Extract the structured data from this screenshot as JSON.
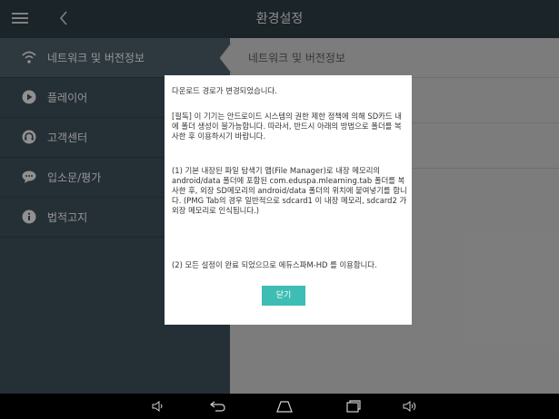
{
  "header": {
    "title": "환경설정",
    "menu_icon": "hamburger-menu-icon",
    "back_icon": "chevron-left-icon"
  },
  "sidebar": {
    "items": [
      {
        "label": "네트워크 및 버전정보",
        "icon": "wifi-icon",
        "active": true
      },
      {
        "label": "플레이어",
        "icon": "play-icon"
      },
      {
        "label": "고객센터",
        "icon": "headset-icon"
      },
      {
        "label": "입소문/평가",
        "icon": "chat-bubble-icon"
      },
      {
        "label": "법적고지",
        "icon": "info-icon"
      }
    ]
  },
  "content": {
    "header": "네트워크 및 버전정보"
  },
  "dialog": {
    "line1": "다운로드 경로가 변경되었습니다.",
    "line2": "[필독] 이 기기는 안드로이드 시스템의 권한 제한 정책에 의해 SD카드 내에 폴더 생성이 불가능합니다. 따라서, 반드시 아래의 방법으로 폴더를 복사한 후 이용하시기 바랍니다.",
    "line3": "(1) 기본 내장된 파일 탐색기 앱(File Manager)로 내장 메모리의 android/data 폴더에 포함된 com.eduspa.mlearning.tab 폴더를 복사한 후, 외장 SD메모리의 android/data 폴더의 위치에 붙여넣기를 합니다. (PMG Tab의 경우 일반적으로 sdcard1 이 내장 메모리, sdcard2 가 외장 메모리로 인식됩니다.)",
    "line4": "(2) 모든 설정이 완료 되었으므로 에듀스파M-HD 를 이용합니다.",
    "close_label": "닫기",
    "accent_color": "#3dbdb3"
  },
  "navbar": {
    "icons": [
      "volume-down-icon",
      "back-icon",
      "home-icon",
      "recent-apps-icon",
      "volume-up-icon"
    ]
  }
}
